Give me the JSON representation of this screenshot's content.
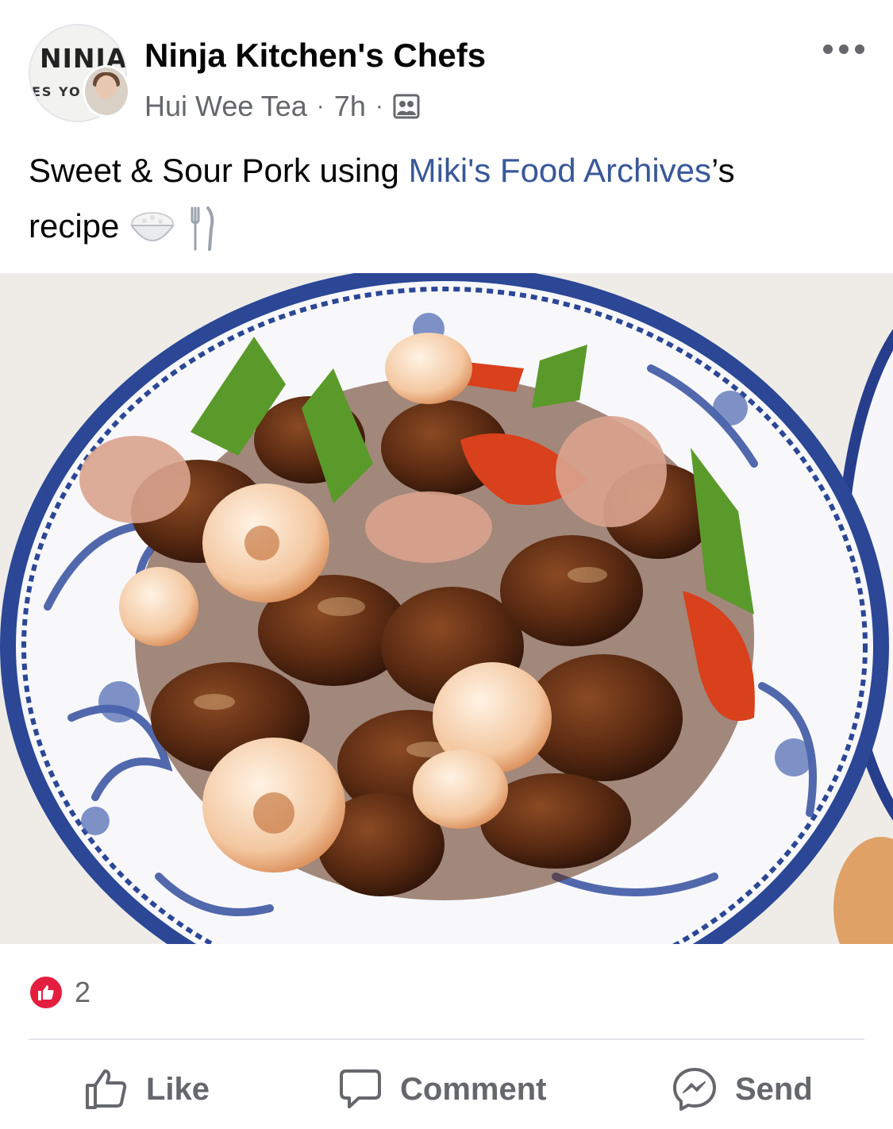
{
  "post": {
    "group_name": "Ninja Kitchen's Chefs",
    "group_logo_text": "NINJA",
    "group_logo_subtext": "ES YO",
    "author": "Hui Wee Tea",
    "separator": "·",
    "time_ago": "7h",
    "audience_icon": "group-audience-icon",
    "text_before_link": "Sweet & Sour Pork using ",
    "link_text": "Miki's Food Archives",
    "text_after_link": "’s",
    "text_line2": "recipe",
    "emoji_1": "rice-bowl-emoji",
    "emoji_2": "fork-and-knife-emoji"
  },
  "reactions": {
    "icon": "like-reaction-icon",
    "count": "2"
  },
  "actions": {
    "like_label": "Like",
    "comment_label": "Comment",
    "send_label": "Send"
  },
  "colors": {
    "link": "#385898",
    "secondary_text": "#65676b",
    "like_badge": "#e41e3f",
    "divider": "#e4e6eb"
  }
}
